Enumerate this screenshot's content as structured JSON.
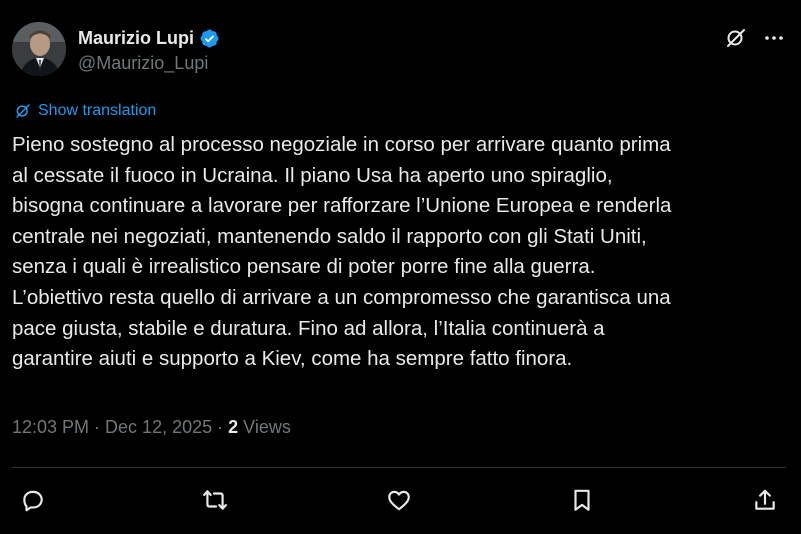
{
  "author": {
    "name": "Maurizio Lupi",
    "handle": "@Maurizio_Lupi",
    "verified": true
  },
  "icons": {
    "avatar": "profile-photo",
    "verified": "verified-badge-icon",
    "grok": "grok-icon",
    "more": "more-icon",
    "translate": "grok-icon",
    "reply": "reply-icon",
    "repost": "repost-icon",
    "like": "heart-icon",
    "bookmark": "bookmark-icon",
    "share": "share-icon"
  },
  "translation": {
    "label": "Show translation"
  },
  "tweet": {
    "lines": [
      "Pieno sostegno al processo negoziale in corso per arrivare quanto prima",
      "al cessate il fuoco in Ucraina. Il piano Usa ha aperto uno spiraglio,",
      "bisogna continuare a lavorare per rafforzare l’Unione Europea e renderla",
      "centrale nei negoziati, mantenendo saldo il rapporto con gli Stati Uniti,",
      "senza i quali è irrealistico pensare di poter porre fine alla guerra.",
      "L’obiettivo resta quello di arrivare a un compromesso che garantisca una",
      "pace giusta, stabile e duratura. Fino ad allora, l’Italia continuerà a",
      "garantire aiuti e supporto a Kiev, come ha sempre fatto finora."
    ]
  },
  "meta": {
    "time": "12:03 PM",
    "separator": "·",
    "date": "Dec 12, 2025",
    "views_count": "2",
    "views_label": "Views"
  },
  "colors": {
    "background": "#000000",
    "text": "#e7e9ea",
    "secondary": "#71767b",
    "accent": "#1d9bf0",
    "divider": "#2f3336"
  }
}
